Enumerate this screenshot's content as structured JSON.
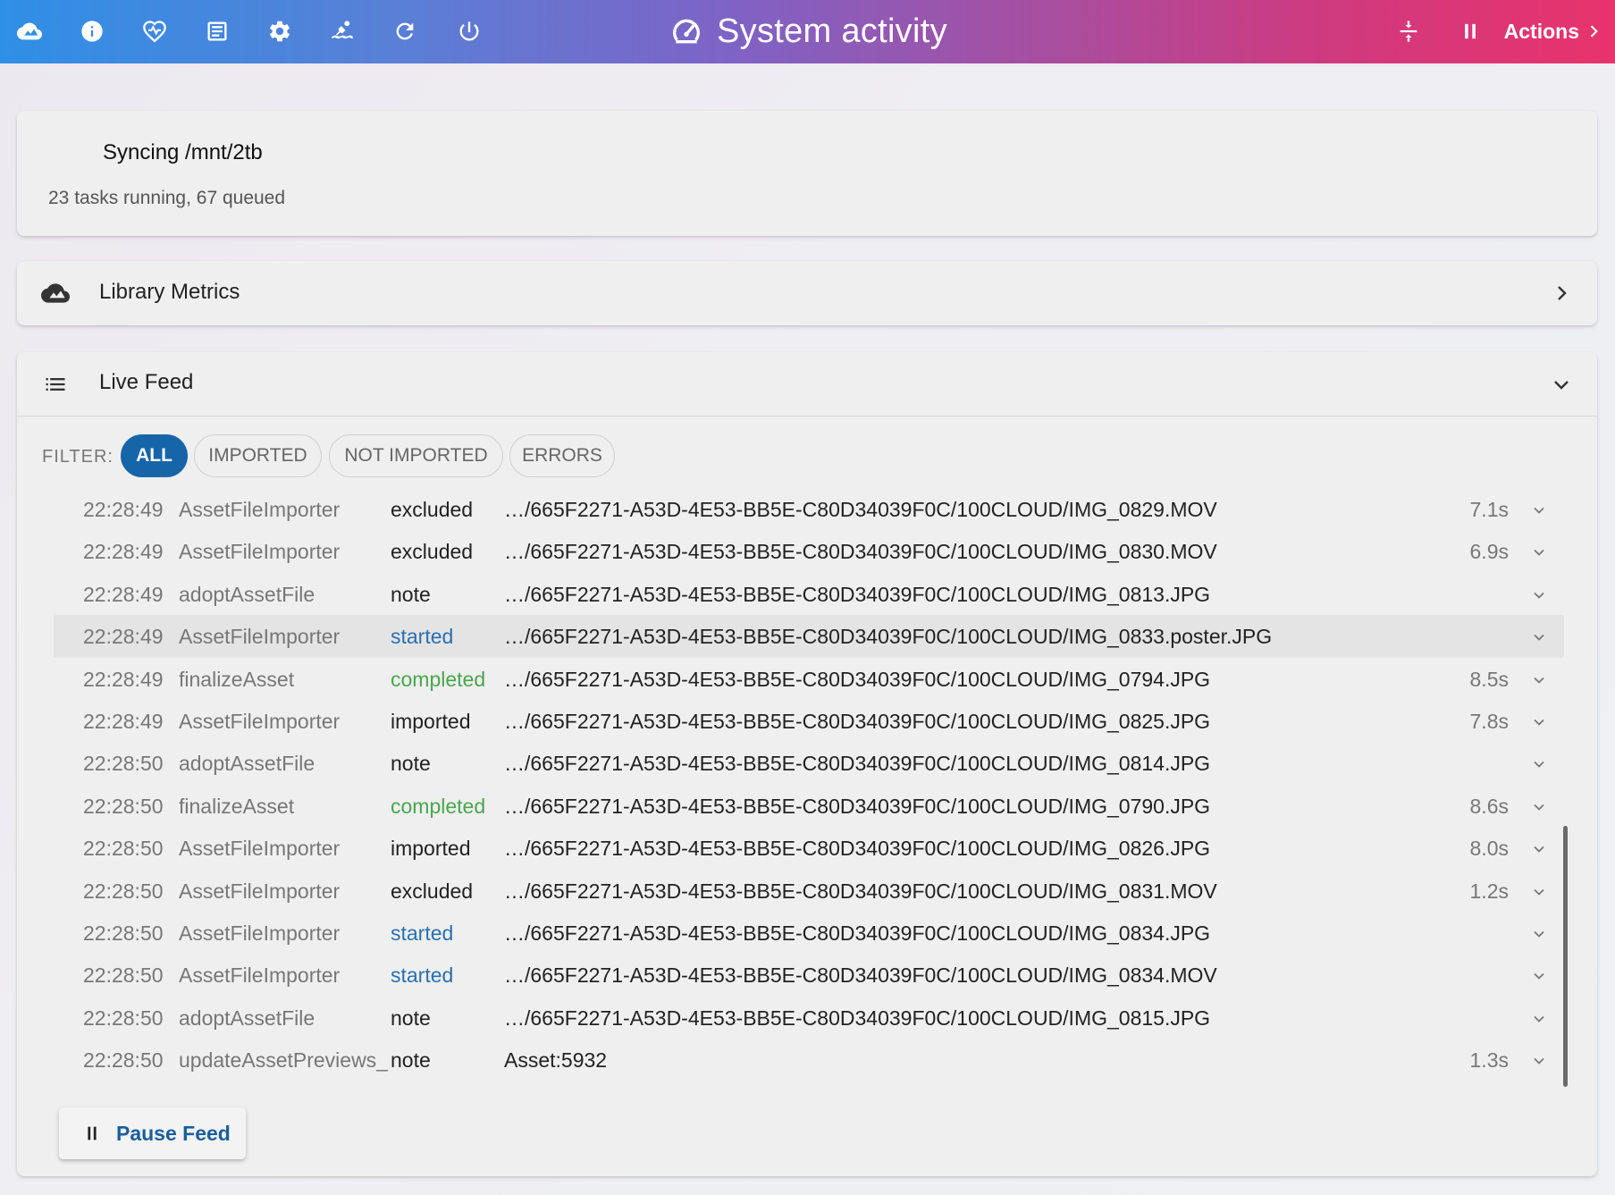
{
  "header": {
    "title": "System activity",
    "nav_icons": [
      "cloud-icon",
      "info-icon",
      "heart-pulse-icon",
      "document-icon",
      "gear-icon",
      "swimmer-icon",
      "refresh-icon",
      "power-icon"
    ],
    "right_icons": [
      "compress-icon",
      "pause-icon"
    ],
    "actions_label": "Actions",
    "accent_colors": [
      "#2f8fe6",
      "#e8336c"
    ]
  },
  "sync": {
    "title": "Syncing /mnt/2tb",
    "subtitle": "23 tasks running, 67 queued"
  },
  "metrics": {
    "label": "Library Metrics"
  },
  "feed": {
    "label": "Live Feed",
    "filter_label": "FILTER:",
    "filters": [
      {
        "label": "ALL",
        "active": true
      },
      {
        "label": "IMPORTED",
        "active": false
      },
      {
        "label": "NOT IMPORTED",
        "active": false
      },
      {
        "label": "ERRORS",
        "active": false
      }
    ],
    "rows": [
      {
        "time": "22:28:49",
        "source": "AssetFileImporter",
        "status": "excluded",
        "path": "…/665F2271-A53D-4E53-BB5E-C80D34039F0C/100CLOUD/IMG_0829.MOV",
        "duration": "7.1s"
      },
      {
        "time": "22:28:49",
        "source": "AssetFileImporter",
        "status": "excluded",
        "path": "…/665F2271-A53D-4E53-BB5E-C80D34039F0C/100CLOUD/IMG_0830.MOV",
        "duration": "6.9s"
      },
      {
        "time": "22:28:49",
        "source": "adoptAssetFile",
        "status": "note",
        "path": "…/665F2271-A53D-4E53-BB5E-C80D34039F0C/100CLOUD/IMG_0813.JPG",
        "duration": ""
      },
      {
        "time": "22:28:49",
        "source": "AssetFileImporter",
        "status": "started",
        "path": "…/665F2271-A53D-4E53-BB5E-C80D34039F0C/100CLOUD/IMG_0833.poster.JPG",
        "duration": ""
      },
      {
        "time": "22:28:49",
        "source": "finalizeAsset",
        "status": "completed",
        "path": "…/665F2271-A53D-4E53-BB5E-C80D34039F0C/100CLOUD/IMG_0794.JPG",
        "duration": "8.5s"
      },
      {
        "time": "22:28:49",
        "source": "AssetFileImporter",
        "status": "imported",
        "path": "…/665F2271-A53D-4E53-BB5E-C80D34039F0C/100CLOUD/IMG_0825.JPG",
        "duration": "7.8s"
      },
      {
        "time": "22:28:50",
        "source": "adoptAssetFile",
        "status": "note",
        "path": "…/665F2271-A53D-4E53-BB5E-C80D34039F0C/100CLOUD/IMG_0814.JPG",
        "duration": ""
      },
      {
        "time": "22:28:50",
        "source": "finalizeAsset",
        "status": "completed",
        "path": "…/665F2271-A53D-4E53-BB5E-C80D34039F0C/100CLOUD/IMG_0790.JPG",
        "duration": "8.6s"
      },
      {
        "time": "22:28:50",
        "source": "AssetFileImporter",
        "status": "imported",
        "path": "…/665F2271-A53D-4E53-BB5E-C80D34039F0C/100CLOUD/IMG_0826.JPG",
        "duration": "8.0s"
      },
      {
        "time": "22:28:50",
        "source": "AssetFileImporter",
        "status": "excluded",
        "path": "…/665F2271-A53D-4E53-BB5E-C80D34039F0C/100CLOUD/IMG_0831.MOV",
        "duration": "1.2s"
      },
      {
        "time": "22:28:50",
        "source": "AssetFileImporter",
        "status": "started",
        "path": "…/665F2271-A53D-4E53-BB5E-C80D34039F0C/100CLOUD/IMG_0834.JPG",
        "duration": ""
      },
      {
        "time": "22:28:50",
        "source": "AssetFileImporter",
        "status": "started",
        "path": "…/665F2271-A53D-4E53-BB5E-C80D34039F0C/100CLOUD/IMG_0834.MOV",
        "duration": ""
      },
      {
        "time": "22:28:50",
        "source": "adoptAssetFile",
        "status": "note",
        "path": "…/665F2271-A53D-4E53-BB5E-C80D34039F0C/100CLOUD/IMG_0815.JPG",
        "duration": ""
      },
      {
        "time": "22:28:50",
        "source": "updateAssetPreviews_",
        "status": "note",
        "path": "Asset:5932",
        "duration": "1.3s"
      }
    ],
    "highlighted_row": 3,
    "status_colors": {
      "started": "#2a6fb0",
      "completed": "#4aa54e"
    },
    "pause_label": "Pause Feed"
  }
}
